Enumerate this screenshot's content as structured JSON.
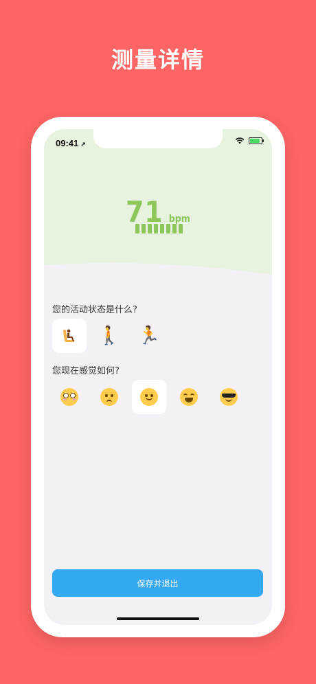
{
  "headline": "测量详情",
  "status_bar": {
    "time": "09:41",
    "location_arrow": "↗"
  },
  "measurement": {
    "value": "71",
    "unit": "bpm",
    "level_bars": 8
  },
  "activity": {
    "question": "您的活动状态是什么?",
    "options": [
      {
        "icon": "seated-person-icon",
        "glyph": "",
        "selected": true
      },
      {
        "icon": "walking-person-icon",
        "glyph": "🚶",
        "selected": false
      },
      {
        "icon": "running-person-icon",
        "glyph": "🏃",
        "selected": false
      }
    ]
  },
  "mood": {
    "question": "您现在感觉如何?",
    "options": [
      {
        "icon": "flushed-face-icon",
        "selected": false
      },
      {
        "icon": "sad-face-icon",
        "selected": false
      },
      {
        "icon": "smiling-face-icon",
        "selected": true
      },
      {
        "icon": "laughing-face-icon",
        "selected": false
      },
      {
        "icon": "sunglasses-face-icon",
        "selected": false
      }
    ]
  },
  "save_button_label": "保存并退出",
  "colors": {
    "background": "#fd6464",
    "accent_green": "#8dc65a",
    "button_blue": "#35a8f4"
  }
}
